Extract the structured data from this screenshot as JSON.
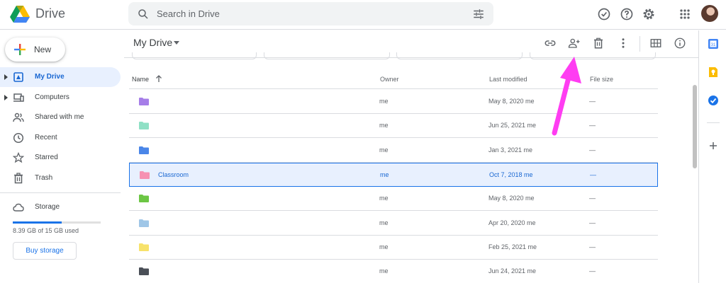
{
  "app": {
    "brand": "Drive"
  },
  "search": {
    "placeholder": "Search in Drive"
  },
  "sidebar": {
    "new_label": "New",
    "items": [
      {
        "label": "My Drive"
      },
      {
        "label": "Computers"
      },
      {
        "label": "Shared with me"
      },
      {
        "label": "Recent"
      },
      {
        "label": "Starred"
      },
      {
        "label": "Trash"
      }
    ],
    "storage_label": "Storage",
    "storage_used": "8.39 GB of 15 GB used",
    "storage_fraction": 0.56,
    "buy_storage": "Buy storage"
  },
  "main": {
    "title": "My Drive",
    "columns": {
      "name": "Name",
      "owner": "Owner",
      "modified": "Last modified",
      "size": "File size"
    },
    "rows": [
      {
        "name": "",
        "owner": "me",
        "modified": "May 8, 2020  me",
        "size": "—",
        "folder_color": "#a67ee8"
      },
      {
        "name": "",
        "owner": "me",
        "modified": "Jun 25, 2021  me",
        "size": "—",
        "folder_color": "#8fe0c5"
      },
      {
        "name": "",
        "owner": "me",
        "modified": "Jan 3, 2021  me",
        "size": "—",
        "folder_color": "#4a86e8"
      },
      {
        "name": "Classroom",
        "owner": "me",
        "modified": "Oct 7, 2018  me",
        "size": "—",
        "folder_color": "#f691b2"
      },
      {
        "name": "",
        "owner": "me",
        "modified": "May 8, 2020  me",
        "size": "—",
        "folder_color": "#6cc644"
      },
      {
        "name": "",
        "owner": "me",
        "modified": "Apr 20, 2020  me",
        "size": "—",
        "folder_color": "#9fc6e7"
      },
      {
        "name": "",
        "owner": "me",
        "modified": "Feb 25, 2021  me",
        "size": "—",
        "folder_color": "#f7e26b"
      },
      {
        "name": "",
        "owner": "me",
        "modified": "Jun 24, 2021  me",
        "size": "—",
        "folder_color": "#4a4f57"
      }
    ]
  },
  "colors": {
    "accent": "#1a73e8",
    "selected_bg": "#e8f0fe",
    "annotation": "#ff3df2"
  }
}
